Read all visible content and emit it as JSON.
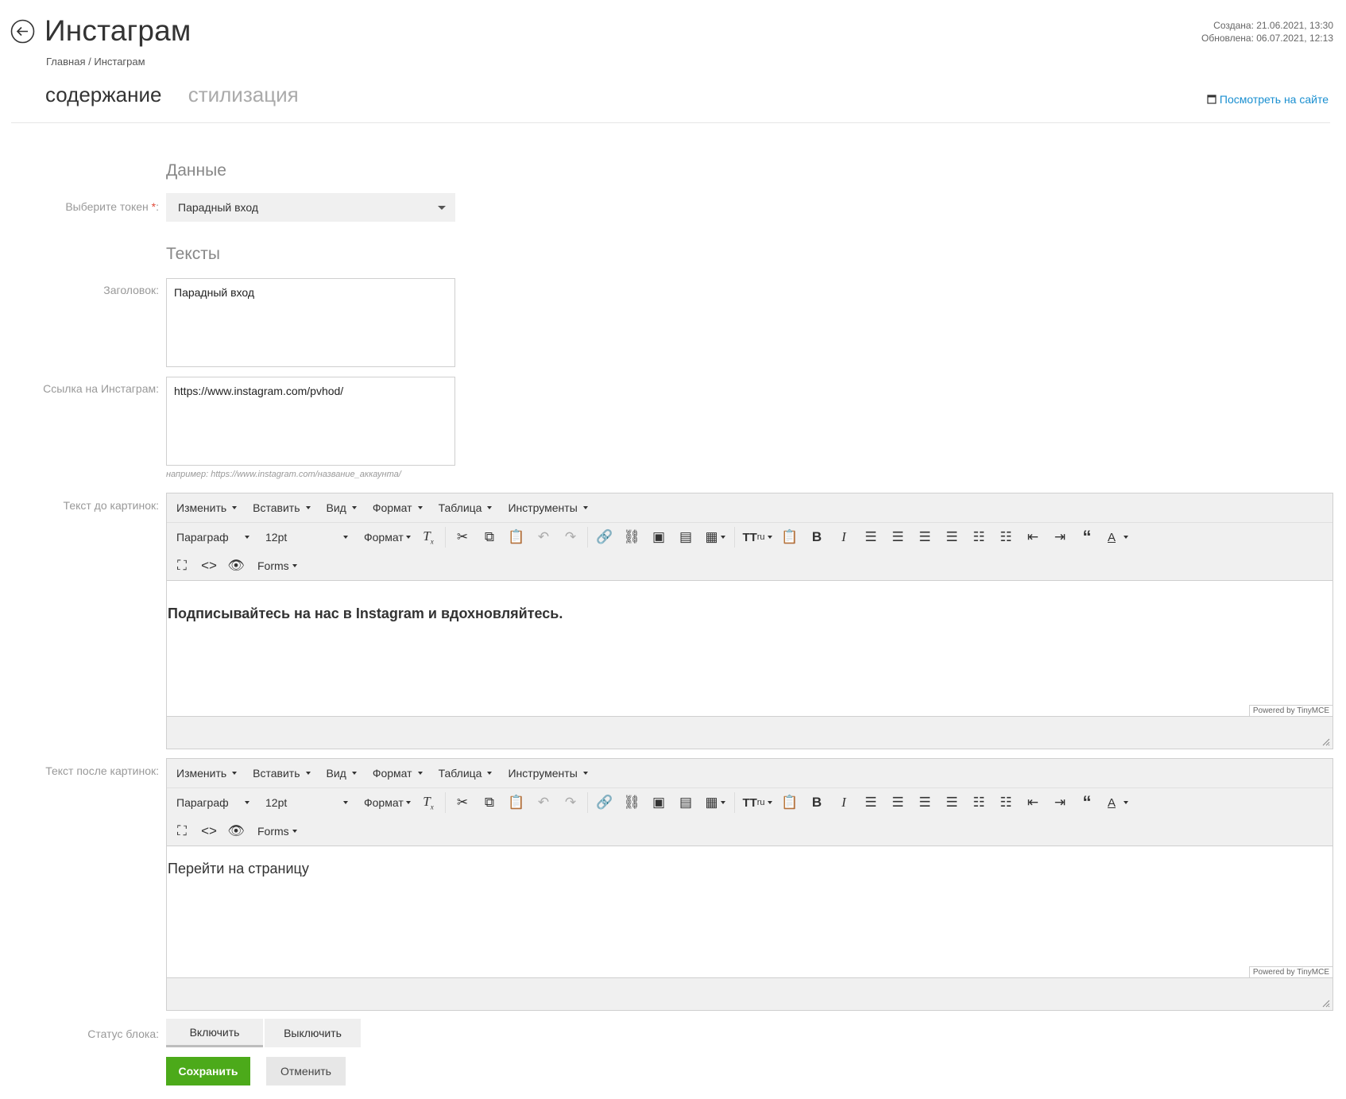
{
  "header": {
    "title": "Инстаграм",
    "breadcrumb": {
      "home": "Главная",
      "separator": "/",
      "current": "Инстаграм"
    },
    "created": "Создана: 21.06.2021, 13:30",
    "updated": "Обновлена: 06.07.2021, 12:13"
  },
  "tabs": [
    {
      "label": "содержание",
      "active": true
    },
    {
      "label": "стилизация",
      "active": false
    }
  ],
  "view_site": "Посмотреть на сайте",
  "sections": {
    "data": "Данные",
    "texts": "Тексты"
  },
  "form": {
    "token_label": "Выберите токен",
    "required_mark": "*",
    "colon": ":",
    "token_value": "Парадный вход",
    "title_label": "Заголовок:",
    "title_value": "Парадный вход",
    "link_label": "Ссылка на Инстаграм:",
    "link_value": "https://www.instagram.com/pvhod/",
    "link_hint": "например: https://www.instagram.com/название_аккаунта/",
    "before_label": "Текст до картинок:",
    "after_label": "Текст после картинок:",
    "status_label": "Статус блока:"
  },
  "editor": {
    "menu": [
      "Изменить",
      "Вставить",
      "Вид",
      "Формат",
      "Таблица",
      "Инструменты"
    ],
    "block_format": "Параграф",
    "font_size": "12pt",
    "format_menu": "Формат",
    "forms_menu": "Forms",
    "powered_by": "Powered by TinyMCE",
    "icons": [
      "clear-format-icon",
      "cut-icon",
      "copy-icon",
      "paste-icon",
      "undo-icon",
      "redo-icon",
      "link-icon",
      "unlink-icon",
      "image-icon",
      "media-icon",
      "table-icon",
      "typography-icon",
      "paste-text-icon",
      "bold-icon",
      "italic-icon",
      "align-left-icon",
      "align-center-icon",
      "align-right-icon",
      "align-justify-icon",
      "bullet-list-icon",
      "numbered-list-icon",
      "outdent-icon",
      "indent-icon",
      "blockquote-icon",
      "text-color-icon",
      "fullscreen-icon",
      "code-icon",
      "preview-icon"
    ]
  },
  "editor_before": {
    "content": "Подписывайтесь на нас в Instagram и вдохновляйтесь."
  },
  "editor_after": {
    "content": "Перейти на страницу"
  },
  "status": {
    "on": "Включить",
    "off": "Выключить",
    "selected": "on"
  },
  "actions": {
    "save": "Сохранить",
    "cancel": "Отменить"
  },
  "colors": {
    "accent_link": "#1a8fd0",
    "save_button": "#4caa1a",
    "required": "#e04a3a"
  }
}
